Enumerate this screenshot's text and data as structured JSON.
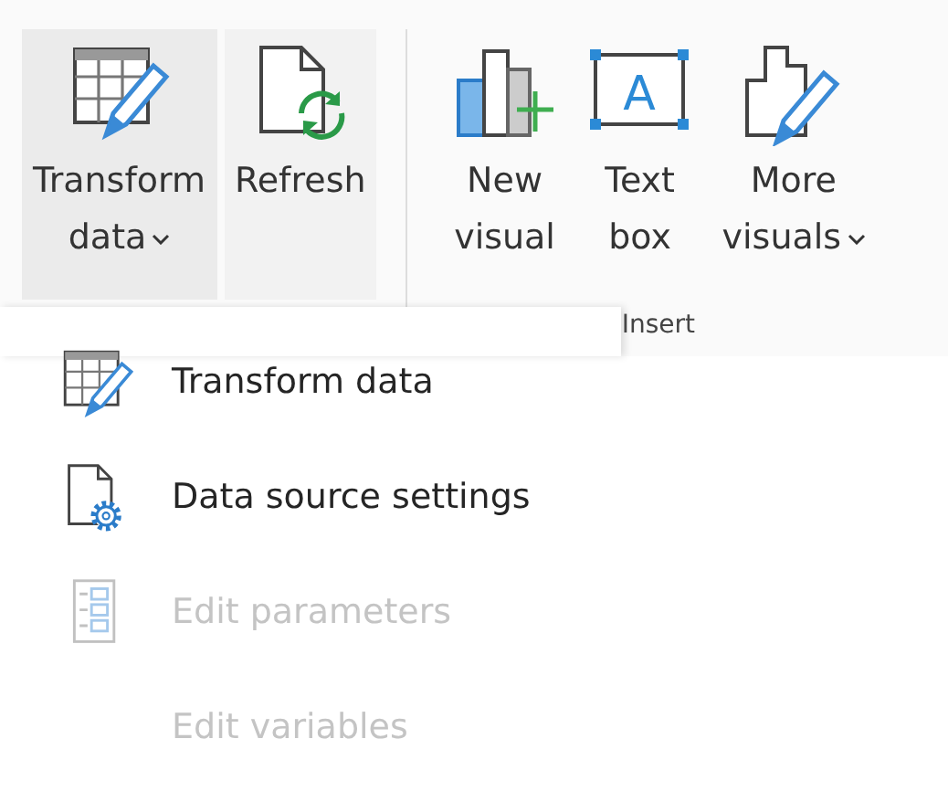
{
  "ribbon": {
    "groups": [
      {
        "buttons": [
          {
            "kind": "transform",
            "lines": [
              "Transform",
              "data"
            ],
            "dropdown": true,
            "expanded": true
          },
          {
            "kind": "refresh",
            "lines": [
              "Refresh"
            ],
            "dropdown": false,
            "expanded": false
          }
        ]
      },
      {
        "label": "Insert",
        "buttons": [
          {
            "kind": "new-visual",
            "lines": [
              "New",
              "visual"
            ],
            "dropdown": false,
            "expanded": false
          },
          {
            "kind": "text-box",
            "glyph": "A",
            "lines": [
              "Text",
              "box"
            ],
            "dropdown": false,
            "expanded": false
          },
          {
            "kind": "more-visuals",
            "lines": [
              "More",
              "visuals"
            ],
            "dropdown": true,
            "expanded": false
          }
        ]
      }
    ]
  },
  "menu": {
    "items": [
      {
        "kind": "transform",
        "label": "Transform data",
        "disabled": false
      },
      {
        "kind": "source-settings",
        "label": "Data source settings",
        "disabled": false
      },
      {
        "kind": "parameters",
        "label": "Edit parameters",
        "disabled": true
      },
      {
        "kind": "none",
        "label": "Edit variables",
        "disabled": true
      }
    ]
  }
}
